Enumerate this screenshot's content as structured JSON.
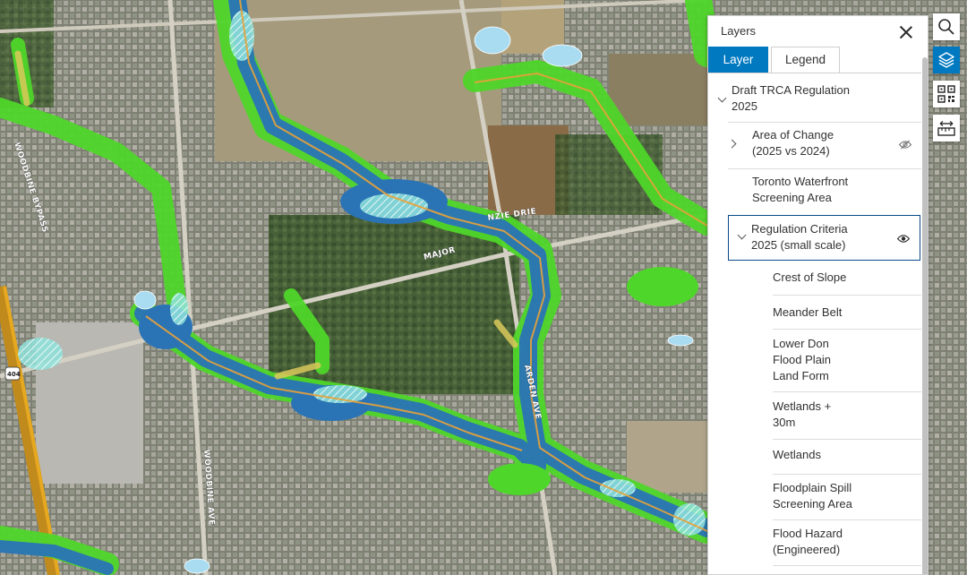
{
  "map": {
    "road_labels": {
      "woodbine_bypass": "WOODBINE BYPASS",
      "major_mackenzie": "MAJOR",
      "major_mackenzie_2": "NZIE DRIE",
      "woodbine_ave": "WOODBINE AVE",
      "warden_ave": "ARDEN AVE",
      "highway_shield": "404"
    },
    "colors": {
      "flood_blue": "#2a74b6",
      "floodplain_green": "#4fd62a",
      "wetland_cyan": "#9fe8e0",
      "crest_orange": "#e8a23a",
      "meander_yellow": "#d9c95a"
    }
  },
  "panel": {
    "title": "Layers",
    "tabs": [
      {
        "label": "Layer",
        "active": true
      },
      {
        "label": "Legend",
        "active": false
      }
    ],
    "group": {
      "line1": "Draft TRCA Regulation",
      "line2": "2025"
    },
    "layers": {
      "change": {
        "line1": "Area of Change",
        "line2": "(2025 vs 2024)",
        "visibility": "hidden"
      },
      "toronto": {
        "line1": "Toronto Waterfront",
        "line2": "Screening Area"
      },
      "criteria": {
        "line1": "Regulation Criteria",
        "line2": "2025 (small scale)",
        "visibility": "visible"
      }
    },
    "sublayers": [
      {
        "lines": [
          "Crest of Slope"
        ]
      },
      {
        "lines": [
          "Meander Belt"
        ]
      },
      {
        "lines": [
          "Lower Don",
          "Flood Plain",
          "Land Form"
        ]
      },
      {
        "lines": [
          "Wetlands +",
          "30m"
        ]
      },
      {
        "lines": [
          "Wetlands"
        ]
      },
      {
        "lines": [
          "Floodplain Spill",
          "Screening Area"
        ]
      },
      {
        "lines": [
          "Flood Hazard",
          "(Engineered)"
        ]
      }
    ]
  },
  "toolbar": {
    "search": "search-icon",
    "layers": "layers-icon",
    "qr": "qr-code-icon",
    "measure": "measure-icon"
  }
}
